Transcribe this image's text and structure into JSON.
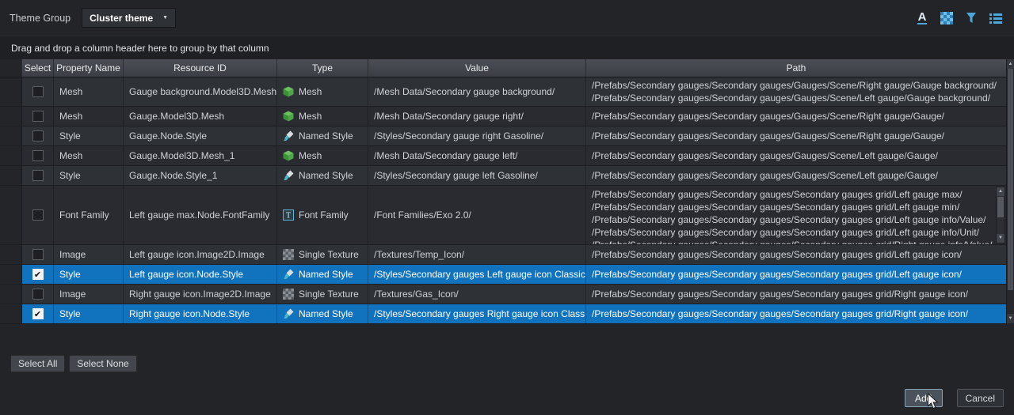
{
  "header": {
    "label": "Theme Group",
    "dropdown_value": "Cluster theme",
    "icons": [
      "font-underline-icon",
      "texture-grid-icon",
      "filter-icon",
      "list-view-icon"
    ]
  },
  "group_bar": {
    "text": "Drag and drop a column header here to group by that column"
  },
  "glyphs": {
    "caret": "▼",
    "check": "✔",
    "arrow_up": "▲",
    "arrow_down": "▼",
    "font_icon": "A"
  },
  "colors": {
    "selection": "#1173bd",
    "accent_icon": "#4aa8dc",
    "mesh_icon_green": "#6abf5e",
    "style_icon_teal": "#4ab6c8"
  },
  "table": {
    "columns": [
      "Select",
      "Property Name",
      "Resource ID",
      "Type",
      "Value",
      "Path"
    ],
    "rows": [
      {
        "checked": false,
        "selected": false,
        "property_name": "Mesh",
        "resource_id": "Gauge background.Model3D.Mesh",
        "type": "Mesh",
        "type_icon": "mesh",
        "value": "/Mesh Data/Secondary gauge background/",
        "paths": [
          "/Prefabs/Secondary gauges/Secondary gauges/Gauges/Scene/Right gauge/Gauge background/",
          "/Prefabs/Secondary gauges/Secondary gauges/Gauges/Scene/Left gauge/Gauge background/"
        ]
      },
      {
        "checked": false,
        "selected": false,
        "property_name": "Mesh",
        "resource_id": "Gauge.Model3D.Mesh",
        "type": "Mesh",
        "type_icon": "mesh",
        "value": "/Mesh Data/Secondary gauge right/",
        "paths": [
          "/Prefabs/Secondary gauges/Secondary gauges/Gauges/Scene/Right gauge/Gauge/"
        ]
      },
      {
        "checked": false,
        "selected": false,
        "property_name": "Style",
        "resource_id": "Gauge.Node.Style",
        "type": "Named Style",
        "type_icon": "named-style",
        "value": "/Styles/Secondary gauge right Gasoline/",
        "paths": [
          "/Prefabs/Secondary gauges/Secondary gauges/Gauges/Scene/Right gauge/Gauge/"
        ]
      },
      {
        "checked": false,
        "selected": false,
        "property_name": "Mesh",
        "resource_id": "Gauge.Model3D.Mesh_1",
        "type": "Mesh",
        "type_icon": "mesh",
        "value": "/Mesh Data/Secondary gauge left/",
        "paths": [
          "/Prefabs/Secondary gauges/Secondary gauges/Gauges/Scene/Left gauge/Gauge/"
        ]
      },
      {
        "checked": false,
        "selected": false,
        "property_name": "Style",
        "resource_id": "Gauge.Node.Style_1",
        "type": "Named Style",
        "type_icon": "named-style",
        "value": "/Styles/Secondary gauge left Gasoline/",
        "paths": [
          "/Prefabs/Secondary gauges/Secondary gauges/Gauges/Scene/Left gauge/Gauge/"
        ]
      },
      {
        "checked": false,
        "selected": false,
        "property_name": "Font Family",
        "resource_id": "Left gauge max.Node.FontFamily",
        "type": "Font Family",
        "type_icon": "font-family",
        "value": "/Font Families/Exo 2.0/",
        "paths": [
          "/Prefabs/Secondary gauges/Secondary gauges/Secondary gauges grid/Left gauge max/",
          "/Prefabs/Secondary gauges/Secondary gauges/Secondary gauges grid/Left gauge min/",
          "/Prefabs/Secondary gauges/Secondary gauges/Secondary gauges grid/Left gauge info/Value/",
          "/Prefabs/Secondary gauges/Secondary gauges/Secondary gauges grid/Left gauge info/Unit/",
          "/Prefabs/Secondary gauges/Secondary gauges/Secondary gauges grid/Right gauge info/Value/"
        ]
      },
      {
        "checked": false,
        "selected": false,
        "property_name": "Image",
        "resource_id": "Left gauge icon.Image2D.Image",
        "type": "Single Texture",
        "type_icon": "single-texture",
        "value": "/Textures/Temp_Icon/",
        "paths": [
          "/Prefabs/Secondary gauges/Secondary gauges/Secondary gauges grid/Left gauge icon/"
        ]
      },
      {
        "checked": true,
        "selected": true,
        "property_name": "Style",
        "resource_id": "Left gauge icon.Node.Style",
        "type": "Named Style",
        "type_icon": "named-style",
        "value": "/Styles/Secondary gauges Left gauge icon Classic/",
        "paths": [
          "/Prefabs/Secondary gauges/Secondary gauges/Secondary gauges grid/Left gauge icon/"
        ]
      },
      {
        "checked": false,
        "selected": false,
        "property_name": "Image",
        "resource_id": "Right gauge icon.Image2D.Image",
        "type": "Single Texture",
        "type_icon": "single-texture",
        "value": "/Textures/Gas_Icon/",
        "paths": [
          "/Prefabs/Secondary gauges/Secondary gauges/Secondary gauges grid/Right gauge icon/"
        ]
      },
      {
        "checked": true,
        "selected": true,
        "property_name": "Style",
        "resource_id": "Right gauge icon.Node.Style",
        "type": "Named Style",
        "type_icon": "named-style",
        "value": "/Styles/Secondary gauges Right gauge icon Classic/",
        "paths": [
          "/Prefabs/Secondary gauges/Secondary gauges/Secondary gauges grid/Right gauge icon/"
        ]
      }
    ]
  },
  "footer": {
    "select_all_label": "Select All",
    "select_none_label": "Select None",
    "add_label": "Add",
    "cancel_label": "Cancel"
  }
}
